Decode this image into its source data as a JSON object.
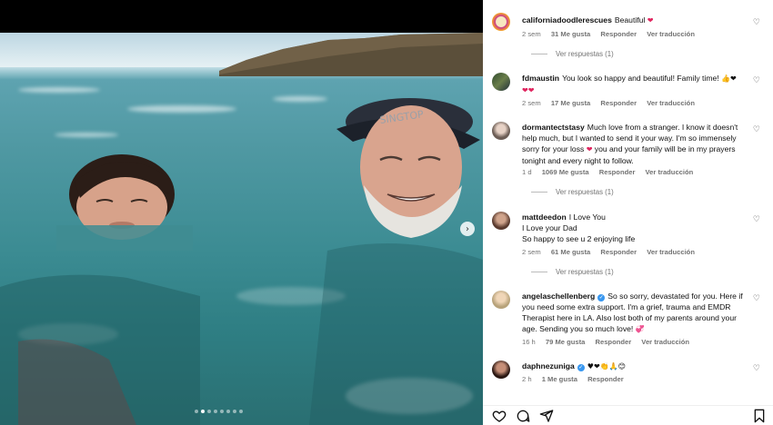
{
  "comments": [
    {
      "user": "californiadoodlerescues",
      "text": "Beautiful",
      "text2": "",
      "emoji": "❤",
      "time": "2 sem",
      "likes": "31 Me gusta",
      "reply": "Responder",
      "translate": "Ver traducción",
      "more_replies": "Ver respuestas (1)"
    },
    {
      "user": "fdmaustin",
      "text": "You look so happy and beautiful! Family time!",
      "emoji": "👍❤",
      "emoji2": "❤❤",
      "time": "2 sem",
      "likes": "17 Me gusta",
      "reply": "Responder",
      "translate": "Ver traducción"
    },
    {
      "user": "dormantectstasy",
      "text": "Much love from a stranger. I know it doesn't help much, but I wanted to send it your way. I'm so immensely sorry for your loss",
      "text_b": "you and your family will be in my prayers tonight and every night to follow.",
      "emoji": "❤",
      "time": "1 d",
      "likes": "1069 Me gusta",
      "reply": "Responder",
      "translate": "Ver traducción",
      "more_replies": "Ver respuestas (1)"
    },
    {
      "user": "mattdeedon",
      "line1": "I Love You",
      "line2": "I Love your Dad",
      "line3": "So happy to see u 2 enjoying life",
      "time": "2 sem",
      "likes": "61 Me gusta",
      "reply": "Responder",
      "translate": "Ver traducción",
      "more_replies": "Ver respuestas (1)"
    },
    {
      "user": "angelaschellenberg",
      "text": "So so sorry, devastated for you. Here if you need some extra support. I'm a grief, trauma and EMDR Therapist here in LA. Also lost both of my parents around your age. Sending you so much love!",
      "emoji": "💞",
      "time": "16 h",
      "likes": "79 Me gusta",
      "reply": "Responder",
      "translate": "Ver traducción"
    },
    {
      "user": "daphnezuniga",
      "emoji": "♥❤👏🙏😊",
      "time": "2 h",
      "likes": "1 Me gusta",
      "reply": "Responder"
    }
  ],
  "icons": {
    "like": "heart-icon",
    "comment": "comment-icon",
    "share": "send-icon",
    "save": "bookmark-icon",
    "next": "chevron-right-icon"
  },
  "colors": {
    "heart_red": "#e0245e",
    "verified_blue": "#3897f0",
    "meta_gray": "#737373"
  }
}
